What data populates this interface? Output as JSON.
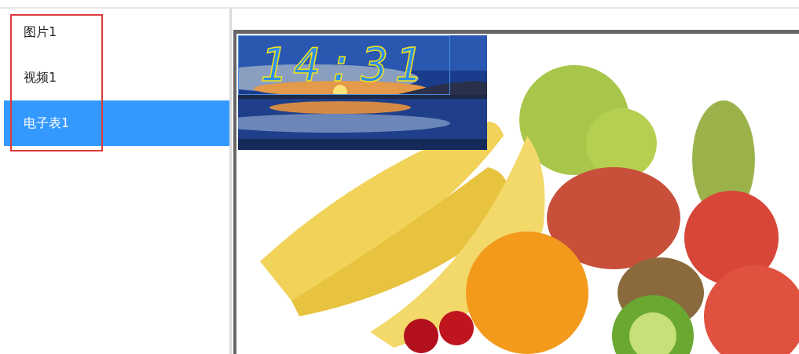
{
  "sidebar": {
    "items": [
      {
        "label": "图片1",
        "selected": false
      },
      {
        "label": "视频1",
        "selected": false
      },
      {
        "label": "电子表1",
        "selected": true
      }
    ]
  },
  "canvas": {
    "clock": {
      "time": "14:31"
    }
  }
}
